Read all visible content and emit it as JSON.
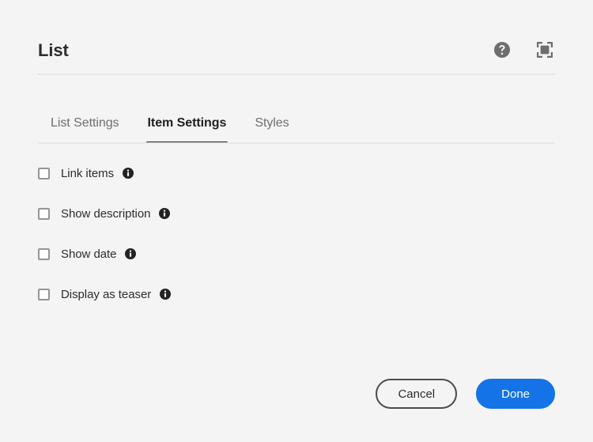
{
  "dialog": {
    "title": "List",
    "header_actions": [
      {
        "name": "help-icon",
        "label": "Help"
      },
      {
        "name": "fullscreen-icon",
        "label": "Fullscreen"
      }
    ]
  },
  "tabs": {
    "items": [
      {
        "label": "List Settings",
        "active": false
      },
      {
        "label": "Item Settings",
        "active": true
      },
      {
        "label": "Styles",
        "active": false
      }
    ]
  },
  "options": [
    {
      "label": "Link items",
      "checked": false,
      "info": "info-icon"
    },
    {
      "label": "Show description",
      "checked": false,
      "info": "info-icon"
    },
    {
      "label": "Show date",
      "checked": false,
      "info": "info-icon"
    },
    {
      "label": "Display as teaser",
      "checked": false,
      "info": "info-icon"
    }
  ],
  "footer": {
    "cancel_label": "Cancel",
    "done_label": "Done"
  },
  "colors": {
    "background": "#f4f4f4",
    "primary": "#1473e6",
    "text": "#2c2c2c",
    "muted_text": "#6e6e6e",
    "border": "#e6e6e6",
    "checkbox_border": "#959595",
    "icon": "#4b4b4b"
  }
}
